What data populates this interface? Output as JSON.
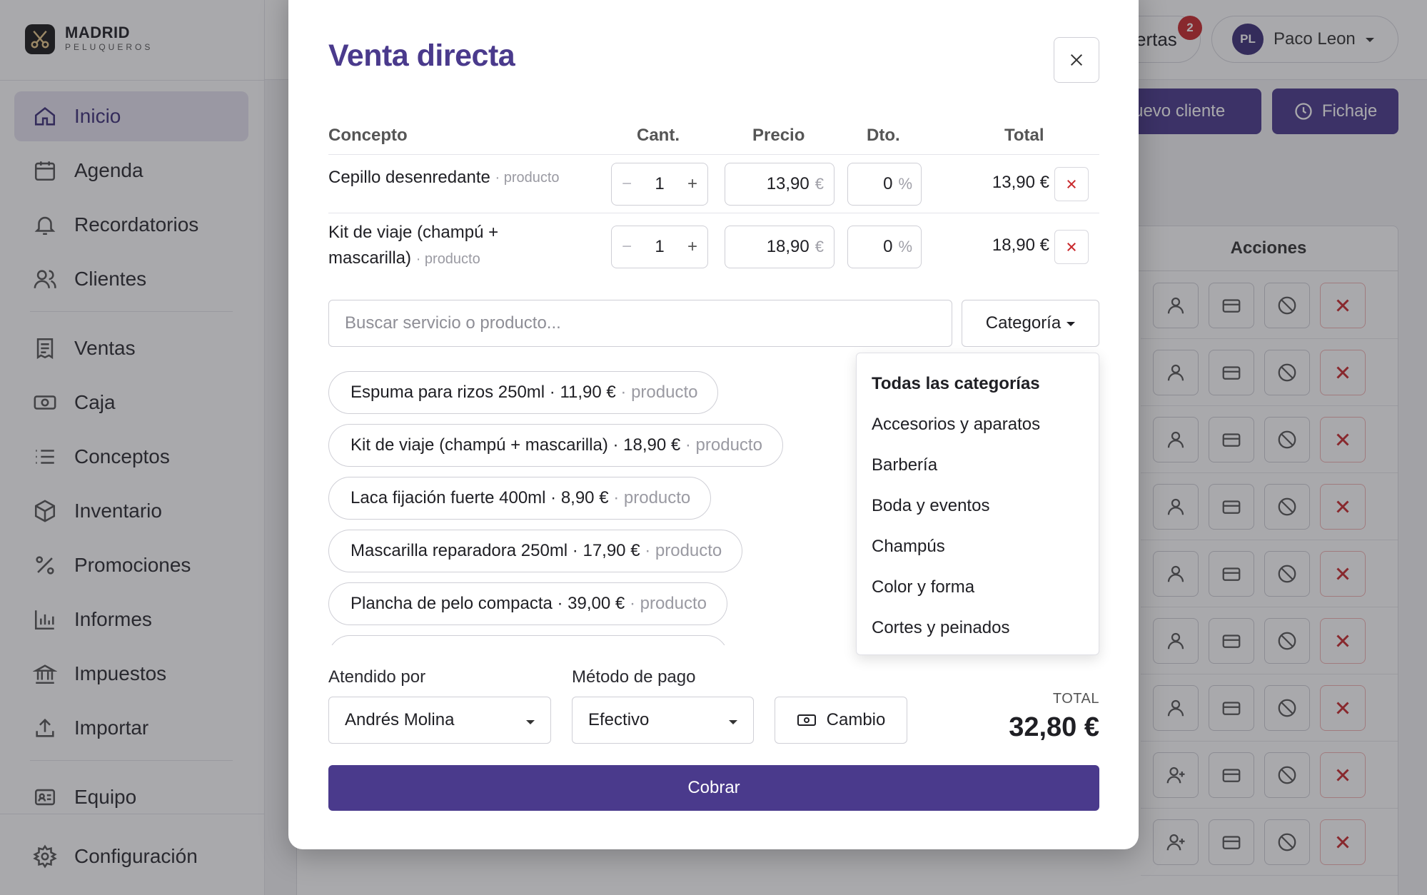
{
  "brand": {
    "name": "MADRID",
    "subtitle": "PELUQUEROS"
  },
  "sidebar": {
    "items": [
      {
        "label": "Inicio",
        "icon": "home-icon",
        "active": true
      },
      {
        "label": "Agenda",
        "icon": "calendar-icon"
      },
      {
        "label": "Recordatorios",
        "icon": "bell-icon"
      },
      {
        "label": "Clientes",
        "icon": "users-icon"
      },
      {
        "label": "Ventas",
        "icon": "receipt-icon"
      },
      {
        "label": "Caja",
        "icon": "cash-icon"
      },
      {
        "label": "Conceptos",
        "icon": "list-icon"
      },
      {
        "label": "Inventario",
        "icon": "box-icon"
      },
      {
        "label": "Promociones",
        "icon": "percent-icon"
      },
      {
        "label": "Informes",
        "icon": "chart-icon"
      },
      {
        "label": "Impuestos",
        "icon": "bank-icon"
      },
      {
        "label": "Importar",
        "icon": "upload-icon"
      },
      {
        "label": "Equipo",
        "icon": "id-card-icon"
      }
    ],
    "settings_label": "Configuración"
  },
  "topbar": {
    "alerts_label": "ertas",
    "alerts_count": "2",
    "user_initials": "PL",
    "user_name": "Paco Leon",
    "new_client_label": "Nuevo cliente",
    "clock_in_label": "Fichaje"
  },
  "table_bg": {
    "actions_header": "Acciones"
  },
  "modal": {
    "title": "Venta directa",
    "columns": {
      "concept": "Concepto",
      "qty": "Cant.",
      "price": "Precio",
      "discount": "Dto.",
      "total": "Total"
    },
    "lines": [
      {
        "name": "Cepillo desenredante",
        "type": "· producto",
        "qty": "1",
        "price": "13,90",
        "discount": "0",
        "total": "13,90 €"
      },
      {
        "name_line1": "Kit de viaje (champú +",
        "name_line2": "mascarilla)",
        "type": "· producto",
        "qty": "1",
        "price": "18,90",
        "discount": "0",
        "total": "18,90 €"
      }
    ],
    "currency": "€",
    "percent": "%",
    "search_placeholder": "Buscar servicio o producto...",
    "category_button": "Categoría",
    "suggestions": [
      {
        "text": "Espuma para rizos 250ml · 11,90 €",
        "type": "· producto"
      },
      {
        "text": "Kit de viaje (champú + mascarilla) · 18,90 €",
        "type": "· producto"
      },
      {
        "text": "Laca fijación fuerte 400ml · 8,90 €",
        "type": "· producto"
      },
      {
        "text": "Mascarilla reparadora 250ml · 17,90 €",
        "type": "· producto"
      },
      {
        "text": "Plancha de pelo compacta · 39,00 €",
        "type": "· producto"
      }
    ],
    "categories": [
      "Todas las categorías",
      "Accesorios y aparatos",
      "Barbería",
      "Boda y eventos",
      "Champús",
      "Color y forma",
      "Cortes y peinados"
    ],
    "attended_label": "Atendido por",
    "attended_value": "Andrés Molina",
    "payment_label": "Método de pago",
    "payment_value": "Efectivo",
    "change_button": "Cambio",
    "total_label": "TOTAL",
    "total_value": "32,80 €",
    "charge_button": "Cobrar"
  },
  "colors": {
    "accent": "#4a3a8c",
    "danger": "#c9292c",
    "active_nav_bg": "#e6e3f0"
  }
}
